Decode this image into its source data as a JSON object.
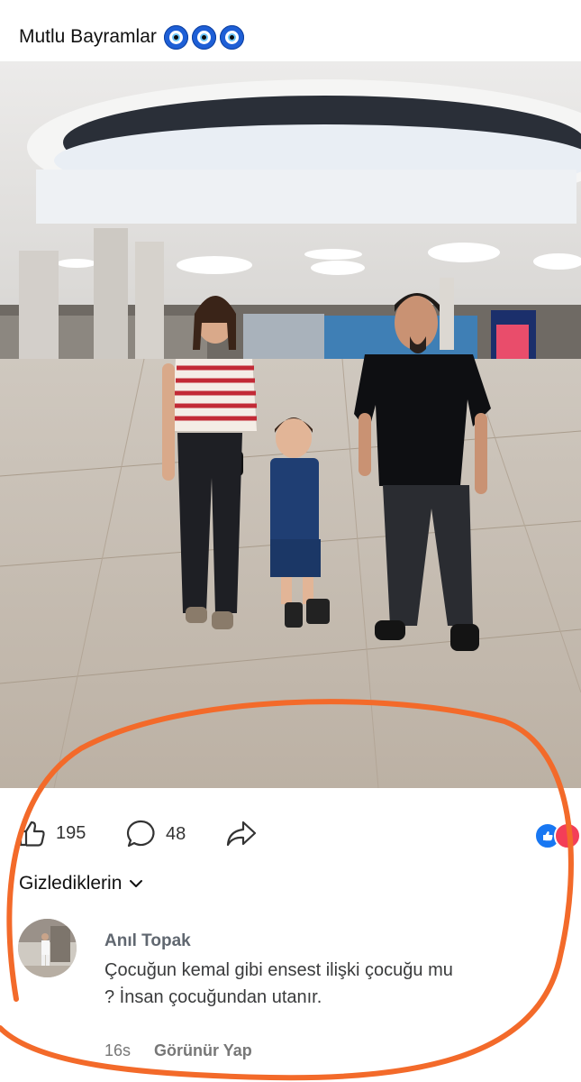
{
  "post": {
    "caption": "Mutlu Bayramlar",
    "caption_icons": [
      "nazar-bead-icon",
      "nazar-bead-icon",
      "nazar-bead-icon"
    ]
  },
  "actions": {
    "like_count": "195",
    "comment_count": "48",
    "reaction_icons": [
      "like-reaction-icon",
      "love-reaction-icon"
    ]
  },
  "comments_filter": {
    "label": "Gizlediklerin"
  },
  "comment": {
    "author": "Anıl Topak",
    "text": "Çocuğun kemal gibi ensest ilişki çocuğu mu\n? İnsan çocuğundan utanır.",
    "time": "16s",
    "reveal_label": "Görünür Yap"
  },
  "colors": {
    "annotation": "#f36a2a",
    "like_blue": "#1877f2",
    "love_red": "#f33e58"
  }
}
